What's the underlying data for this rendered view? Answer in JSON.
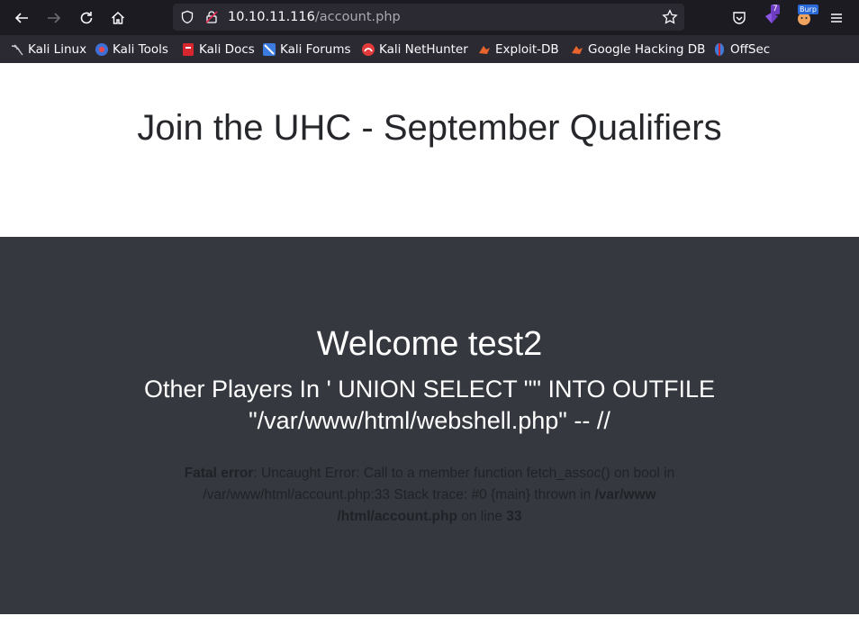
{
  "browser": {
    "url_host": "10.10.11.116",
    "url_path": "/account.php",
    "extension_badge_count": "7",
    "burp_badge": "Burp"
  },
  "bookmarks": [
    {
      "label": "Kali Linux",
      "icon": "kali-dragon-icon"
    },
    {
      "label": "Kali Tools",
      "icon": "kali-tools-icon"
    },
    {
      "label": "Kali Docs",
      "icon": "kali-docs-icon"
    },
    {
      "label": "Kali Forums",
      "icon": "kali-forums-icon"
    },
    {
      "label": "Kali NetHunter",
      "icon": "kali-nethunter-icon"
    },
    {
      "label": "Exploit-DB",
      "icon": "exploit-db-icon"
    },
    {
      "label": "Google Hacking DB",
      "icon": "ghdb-icon"
    },
    {
      "label": "OffSec",
      "icon": "offsec-icon"
    }
  ],
  "page": {
    "title": "Join the UHC - September Qualifiers",
    "welcome": "Welcome test2",
    "others": "Other Players In ' UNION SELECT \"\" INTO OUTFILE \"/var/www/html/webshell.php\" -- //",
    "error": {
      "label": "Fatal error",
      "message": ": Uncaught Error: Call to a member function fetch_assoc() on bool in /var/www/html/account.php:33 Stack trace: #0 {main} thrown in ",
      "file": "/var/www /html/account.php",
      "on_line": " on line ",
      "line": "33"
    }
  },
  "colors": {
    "toolbar_bg": "#1c1b22",
    "bookmarks_bg": "#2b2a33",
    "dark_section_bg": "#35393f",
    "title_color": "#25272b"
  }
}
